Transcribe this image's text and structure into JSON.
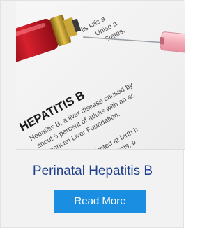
{
  "card": {
    "image_name": "hepatitis-b-document-with-syringe",
    "image_text": {
      "heading": "HEPATITIS B",
      "line1": "Hepatitis B, a liver disease caused by",
      "line2": "about 5 percent of adults with an ac",
      "line3": "American Liver Foundation.",
      "line4": "Children infected at birth h",
      "line5": "shows no symptoms, p",
      "top1": "lis kills a",
      "top2": "Uniso a",
      "top3": "States."
    },
    "title": "Perinatal Hepatitis B",
    "button_label": "Read More"
  },
  "colors": {
    "title": "#1f3f8a",
    "button_bg": "#1a8ee0",
    "button_text": "#ffffff",
    "card_bg": "#f2f2f2"
  }
}
